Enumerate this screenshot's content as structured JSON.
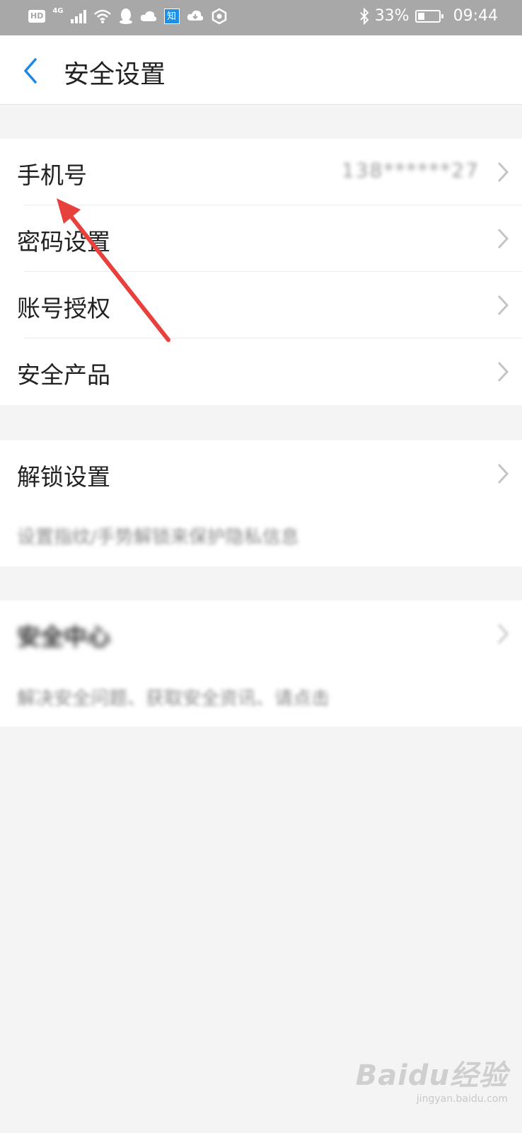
{
  "status_bar": {
    "hd_badge": "HD",
    "network": "4G",
    "app_badge": "知",
    "battery_percent": "33%",
    "battery_level": 0.33,
    "time": "09:44",
    "icons": [
      "hd-icon",
      "signal-icon",
      "wifi-icon",
      "qq-icon",
      "cloud-icon",
      "zhihu-icon",
      "cloud-download-icon",
      "shield-icon",
      "bluetooth-icon",
      "battery-icon"
    ]
  },
  "header": {
    "title": "安全设置",
    "back_icon": "chevron-left-icon",
    "accent_color": "#1f87e5"
  },
  "group1": {
    "items": [
      {
        "label": "手机号",
        "value": "138******27"
      },
      {
        "label": "密码设置"
      },
      {
        "label": "账号授权"
      },
      {
        "label": "安全产品"
      }
    ]
  },
  "group2": {
    "label": "解锁设置",
    "description": "设置指纹/手势解锁来保护隐私信息"
  },
  "group3": {
    "label": "安全中心",
    "description": "解决安全问题、获取安全资讯、请点击"
  },
  "annotation": {
    "color": "#e8413d",
    "target": "phone-number-item"
  },
  "watermark": {
    "main": "Baidu经验",
    "sub": "jingyan.baidu.com"
  }
}
